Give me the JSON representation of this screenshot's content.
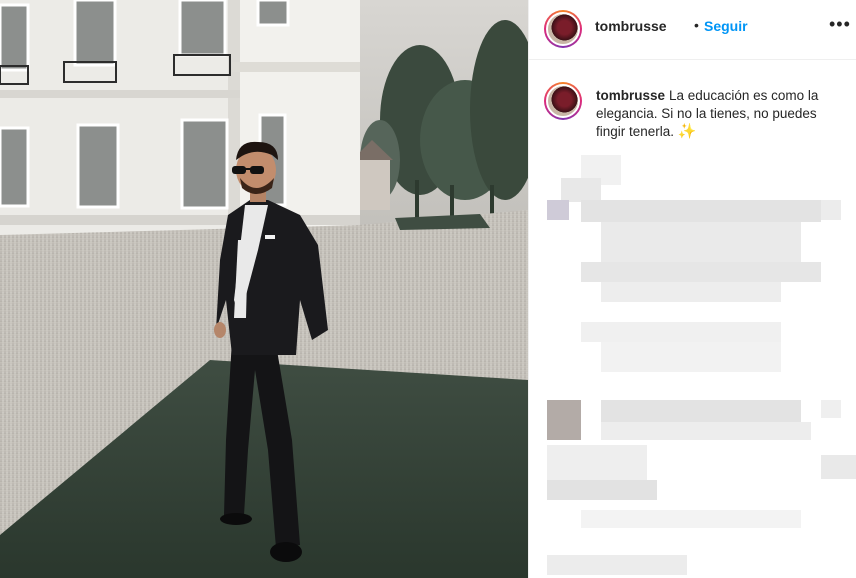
{
  "post": {
    "username": "tombrusse",
    "separator": "•",
    "follow_label": "Seguir",
    "more_label": "•••",
    "caption_username": "tombrusse",
    "caption_text": "La educación es como la elegancia. Si no la tienes, no puedes fingir tenerla.",
    "caption_emoji": "✨"
  },
  "colors": {
    "follow_blue": "#0095f6",
    "text": "#262626",
    "border": "#efefef"
  },
  "icons": {
    "avatar": "profile-avatar",
    "more": "more-options-icon",
    "emoji": "sparkles-icon"
  }
}
